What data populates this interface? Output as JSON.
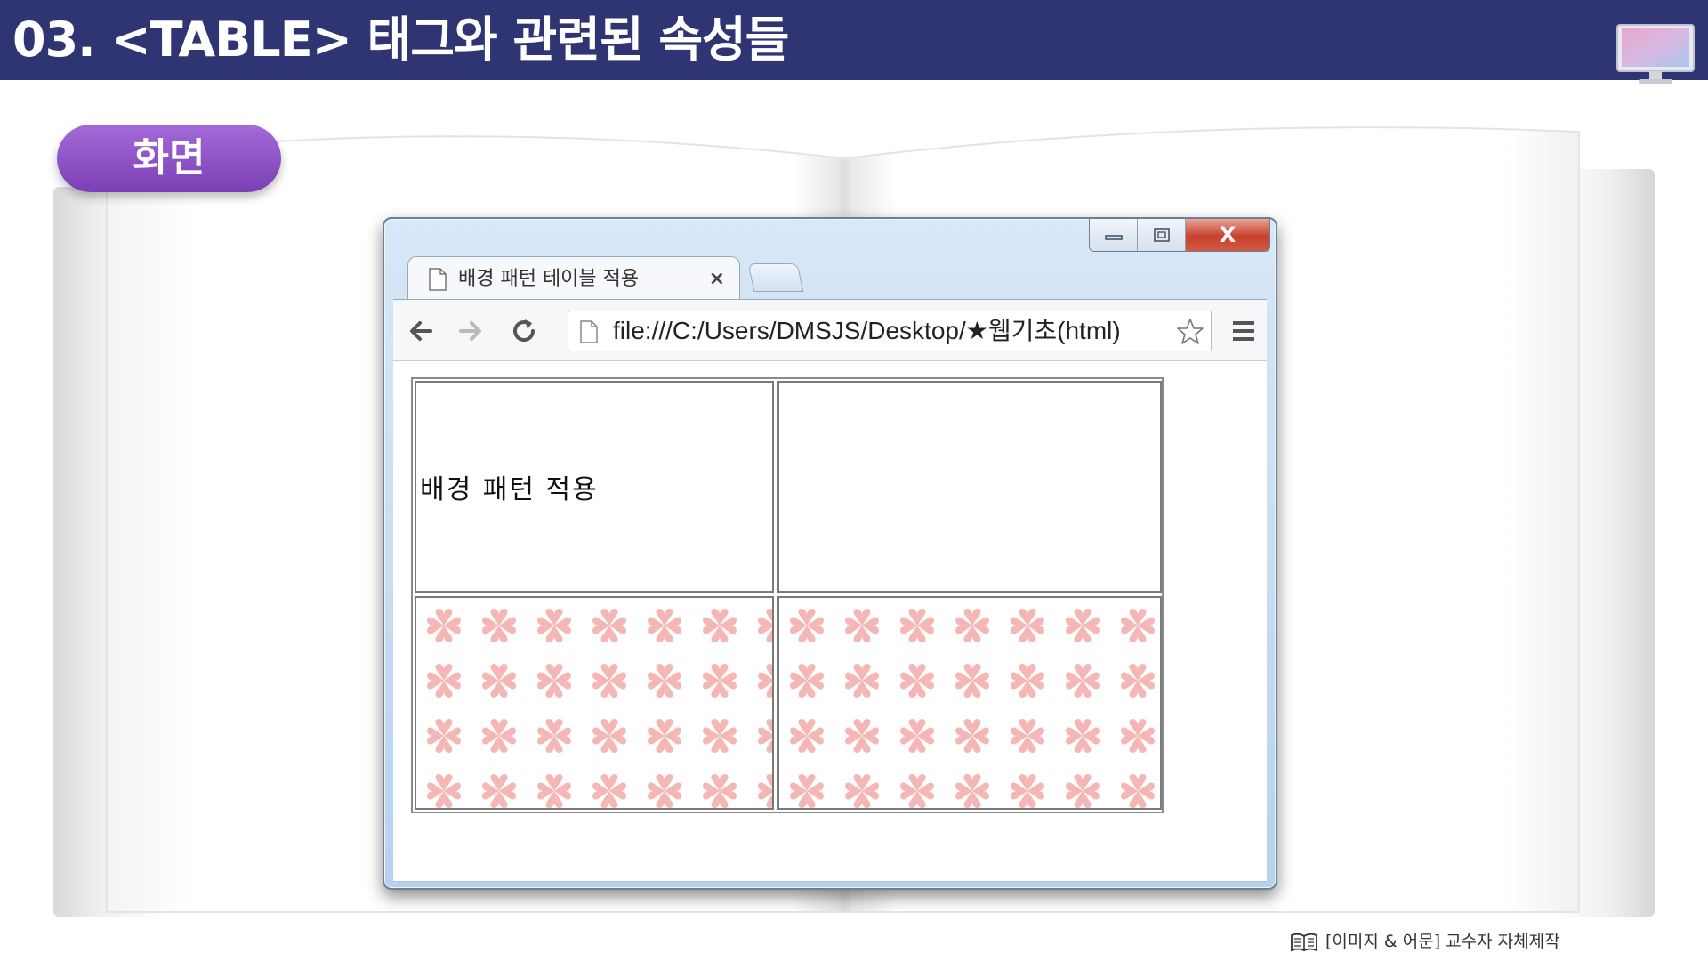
{
  "header": {
    "title": "03. <TABLE> 태그와 관련된 속성들",
    "monitor_icon": "monitor-icon"
  },
  "section": {
    "label": "화면",
    "color": "#8e4fc7"
  },
  "browser": {
    "tab": {
      "title": "배경 패턴 테이블 적용",
      "close": "×"
    },
    "address": "file:///C:/Users/DMSJS/Desktop/★웹기초(html)",
    "window_controls": {
      "minimize_icon": "minimize-icon",
      "maximize_icon": "maximize-icon",
      "close_label": "X"
    },
    "toolbar_icons": [
      "back-arrow-icon",
      "forward-arrow-icon",
      "reload-icon",
      "star-icon",
      "menu-icon"
    ]
  },
  "table": {
    "rows": [
      [
        {
          "text": "배경 패턴 적용"
        },
        {
          "text": ""
        }
      ],
      [
        {
          "pattern": "pink-heart-cross"
        },
        {
          "pattern": "pink-heart-cross"
        }
      ]
    ],
    "pattern_color": "#f5b7b5"
  },
  "caption": {
    "text": "[이미지 & 어문] 교수자 자체제작",
    "icon": "book-icon"
  },
  "colors": {
    "header_bg": "#2f3573",
    "window_frame": "#c4dcf2"
  }
}
